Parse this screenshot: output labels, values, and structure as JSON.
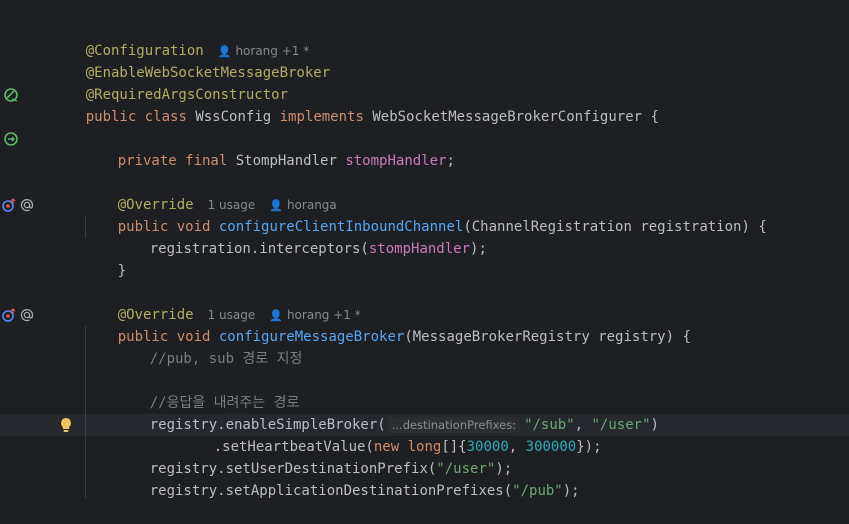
{
  "hints": {
    "class_author": "horang +1 *",
    "usage": "1 usage",
    "m1_author": "horanga",
    "m2_author": "horang +1 *",
    "param_name": "...destinationPrefixes:"
  },
  "code": {
    "l1": "@Configuration",
    "l2": "@EnableWebSocketMessageBroker",
    "l3": "@RequiredArgsConstructor",
    "l4_public": "public",
    "l4_class": " class ",
    "l4_name": "WssConfig ",
    "l4_impl": "implements",
    "l4_rest": " WebSocketMessageBrokerConfigurer {",
    "l6_pf": "private final",
    "l6_type": " StompHandler ",
    "l6_field": "stompHandler",
    "l6_end": ";",
    "override": "@Override",
    "pv": "public void",
    "m1_name": "configureClientInboundChannel",
    "m1_params": "(ChannelRegistration registration) {",
    "m1_body_a": "registration.interceptors(",
    "m1_body_field": "stompHandler",
    "m1_body_b": ");",
    "close": "}",
    "m2_name": "configureMessageBroker",
    "m2_params": "(MessageBrokerRegistry registry) {",
    "cmt1": "//pub, sub 경로 지정",
    "cmt2": "//응답을 내려주는 경로",
    "b1_a": "registry.enableSimpleBroker(",
    "b1_s1": "\"/sub\"",
    "b1_c": ", ",
    "b1_s2": "\"/user\"",
    "b1_e": ")",
    "b2_a": ".setHeartbeatValue(",
    "b2_new": "new",
    "b2_long": " long",
    "b2_br": "[]{",
    "b2_n1": "30000",
    "b2_cm": ", ",
    "b2_n2": "300000",
    "b2_end": "});",
    "b3_a": "registry.setUserDestinationPrefix(",
    "b3_s": "\"/user\"",
    "b3_e": ");",
    "b4_a": "registry.setApplicationDestinationPrefixes(",
    "b4_s": "\"/pub\"",
    "b4_e": ");"
  },
  "icons": [
    "bean-icon",
    "bean-injected-icon",
    "override-method-icon",
    "at-annotation-icon",
    "lightbulb-icon",
    "user-icon"
  ],
  "colors": {
    "background": "#1e1f22",
    "annotation": "#b3ae60",
    "keyword": "#cf8e6d",
    "field": "#c77dbb",
    "method": "#56a8f5",
    "string": "#6aab73",
    "number": "#2aacb8",
    "comment": "#7a7e85"
  }
}
